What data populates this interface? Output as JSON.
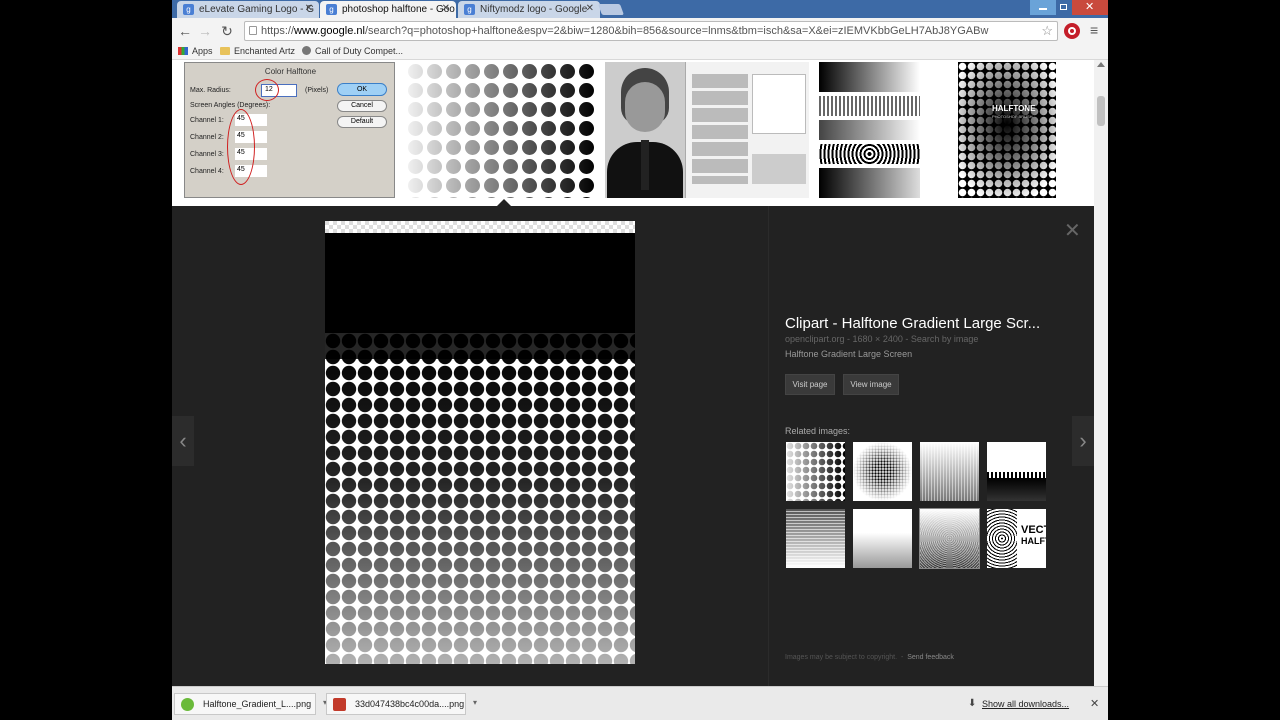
{
  "tabs": [
    {
      "label": "eLevate Gaming Logo - G"
    },
    {
      "label": "photoshop halftone - Goo"
    },
    {
      "label": "Niftymodz logo - Google"
    }
  ],
  "toolbar": {
    "url_scheme": "https://",
    "url_host": "www.google.nl",
    "url_path": "/search?q=photoshop+halftone&espv=2&biw=1280&bih=856&source=lnms&tbm=isch&sa=X&ei=zIEMVKbbGeLH7AbJ8YGABw"
  },
  "bookmarks": [
    {
      "label": "Apps"
    },
    {
      "label": "Enchanted Artz"
    },
    {
      "label": "Call of Duty Compet..."
    }
  ],
  "dialog": {
    "title": "Color Halftone",
    "max_radius_label": "Max. Radius:",
    "max_radius_value": "12",
    "pixels_label": "(Pixels)",
    "screen_angles_label": "Screen Angles (Degrees):",
    "channels": [
      {
        "label": "Channel 1:",
        "value": "45"
      },
      {
        "label": "Channel 2:",
        "value": "45"
      },
      {
        "label": "Channel 3:",
        "value": "45"
      },
      {
        "label": "Channel 4:",
        "value": "45"
      }
    ],
    "ok_label": "OK",
    "cancel_label": "Cancel",
    "default_label": "Default"
  },
  "thumb_halftone": {
    "title": "HALFTONE",
    "subtitle": "PHOTOSHOP BRUSH"
  },
  "viewer": {
    "title": "Clipart - Halftone Gradient Large Scr...",
    "meta": "openclipart.org - 1680 × 2400 - Search by image",
    "description": "Halftone Gradient Large Screen",
    "visit_label": "Visit page",
    "view_label": "View image",
    "related_label": "Related images:",
    "copyright": "Images may be subject to copyright.",
    "feedback": "Send feedback",
    "related_text": {
      "line1": "VECT",
      "line2": "HALFT"
    }
  },
  "downloads": [
    {
      "label": "Halftone_Gradient_L....png"
    },
    {
      "label": "33d047438bc4c00da....png"
    }
  ],
  "show_all_label": "Show all downloads..."
}
